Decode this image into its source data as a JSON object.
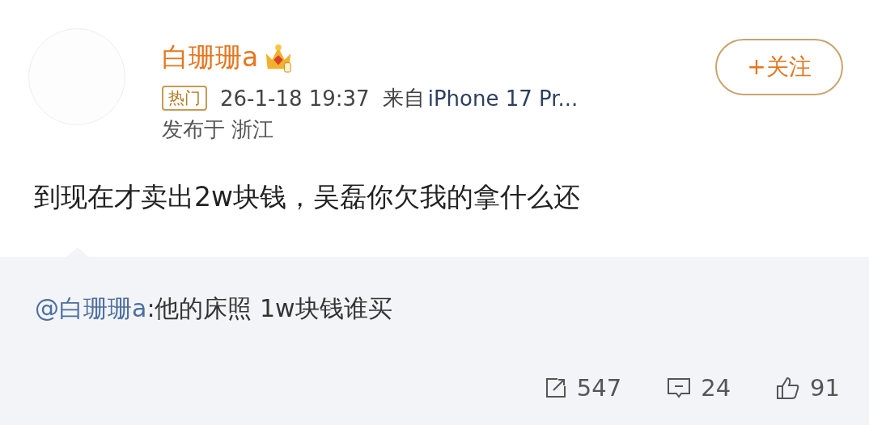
{
  "author": {
    "name": "白珊珊a",
    "badge": "热门",
    "time": "26-1-18 19:37",
    "source_prefix": "来自",
    "source": "iPhone 17 Pr...",
    "location": "发布于 浙江"
  },
  "follow_button": "+关注",
  "post_text": "到现在才卖出2w块钱，吴磊你欠我的拿什么还",
  "repost": {
    "mention": "@白珊珊a",
    "text": ":他的床照 1w块钱谁买"
  },
  "actions": [
    {
      "kind": "repost",
      "count": "547"
    },
    {
      "kind": "comment",
      "count": "24"
    },
    {
      "kind": "like",
      "count": "91"
    }
  ]
}
